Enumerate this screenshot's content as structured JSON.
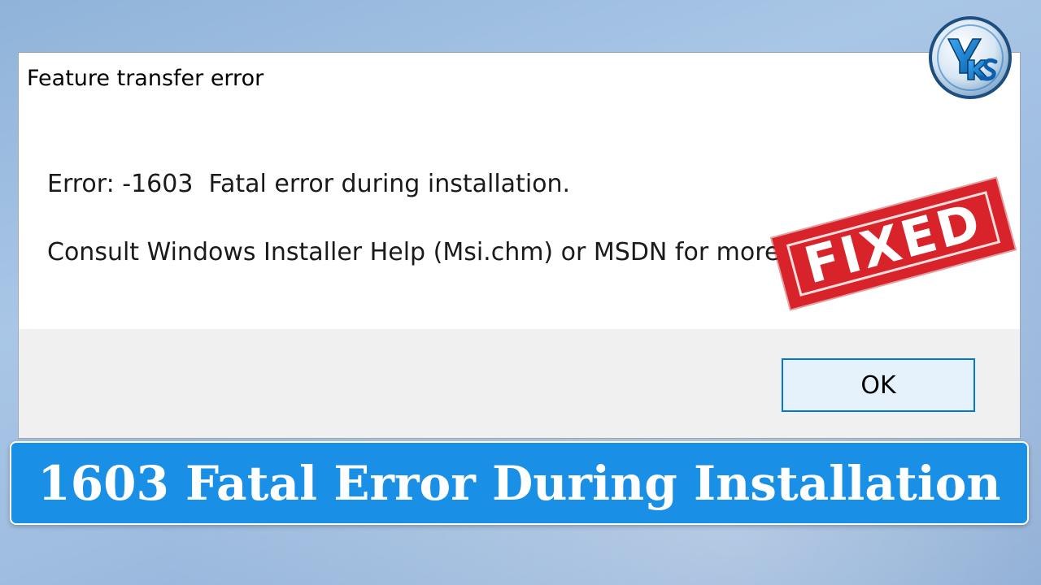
{
  "dialog": {
    "title": "Feature transfer error",
    "error_line": "Error: -1603  Fatal error during installation.",
    "help_line": "Consult Windows Installer Help (Msi.chm) or MSDN for more",
    "ok_label": "OK"
  },
  "stamp": {
    "text": "FIXED",
    "color": "#d8232a"
  },
  "logo": {
    "text": "YKS",
    "icon": "yks-logo-icon"
  },
  "banner": {
    "text": "1603 Fatal Error During Installation",
    "color": "#1a8fe6"
  }
}
